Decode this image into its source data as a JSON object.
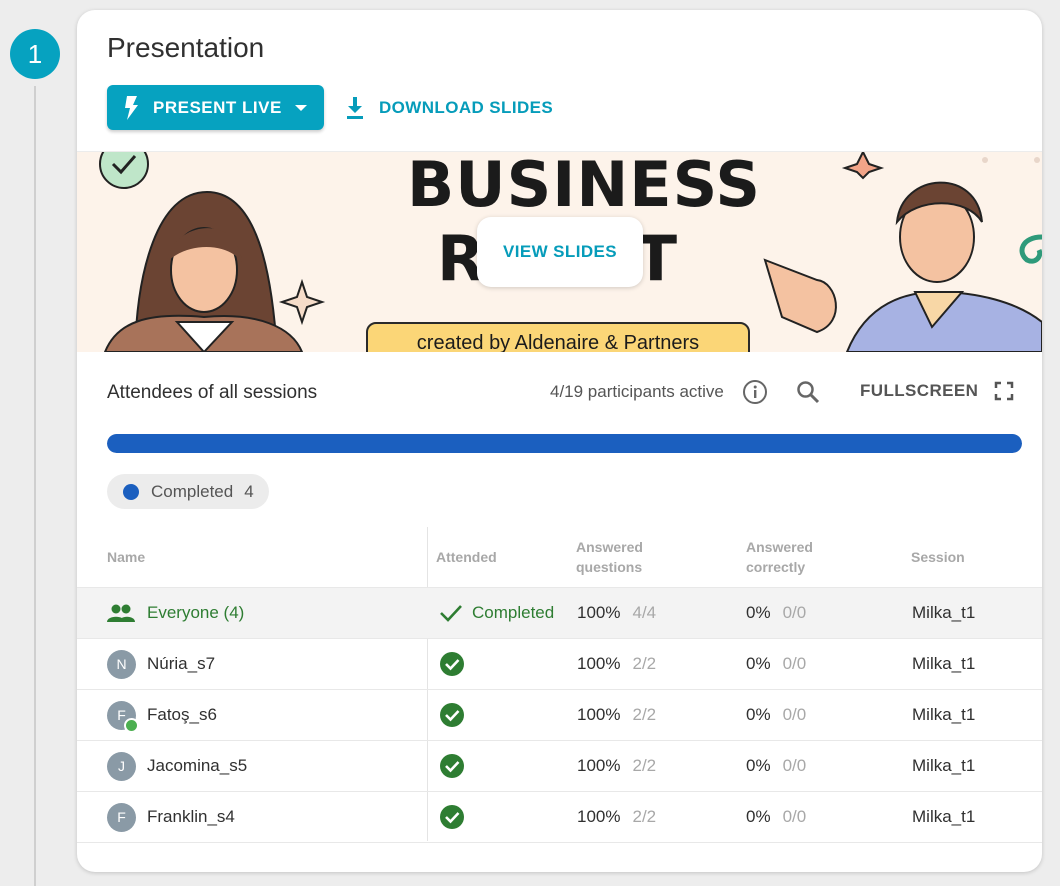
{
  "step": {
    "number": "1"
  },
  "card": {
    "title": "Presentation",
    "present_label": "PRESENT LIVE",
    "download_label": "DOWNLOAD SLIDES",
    "view_slides_label": "VIEW SLIDES"
  },
  "slide": {
    "line1": "BUSINESS",
    "line2_start": "R",
    "line2_end": "T",
    "banner": "created by Aldenaire & Partners"
  },
  "attendees": {
    "title": "Attendees of all sessions",
    "active_text": "4/19 participants active",
    "fullscreen_label": "FULLSCREEN",
    "progress_fraction": 1.0,
    "progress_color": "#1b5fbf",
    "chip_label": "Completed",
    "chip_count": "4"
  },
  "table": {
    "headers": {
      "name": "Name",
      "attended": "Attended",
      "answered_1": "Answered",
      "answered_2": "questions",
      "correct_1": "Answered",
      "correct_2": "correctly",
      "session": "Session"
    },
    "group": {
      "name": "Everyone (4)",
      "attended": "Completed",
      "answered_pct": "100%",
      "answered_frac": "4/4",
      "correct_pct": "0%",
      "correct_frac": "0/0",
      "session": "Milka_t1"
    },
    "rows": [
      {
        "initial": "N",
        "name": "Núria_s7",
        "answered_pct": "100%",
        "answered_frac": "2/2",
        "correct_pct": "0%",
        "correct_frac": "0/0",
        "session": "Milka_t1"
      },
      {
        "initial": "F",
        "name": "Fatoş_s6",
        "answered_pct": "100%",
        "answered_frac": "2/2",
        "correct_pct": "0%",
        "correct_frac": "0/0",
        "session": "Milka_t1"
      },
      {
        "initial": "J",
        "name": "Jacomina_s5",
        "answered_pct": "100%",
        "answered_frac": "2/2",
        "correct_pct": "0%",
        "correct_frac": "0/0",
        "session": "Milka_t1"
      },
      {
        "initial": "F",
        "name": "Franklin_s4",
        "answered_pct": "100%",
        "answered_frac": "2/2",
        "correct_pct": "0%",
        "correct_frac": "0/0",
        "session": "Milka_t1"
      }
    ]
  },
  "colors": {
    "accent": "#06a2c0",
    "success": "#2e7d32",
    "progress": "#1b5fbf"
  },
  "icons": [
    "bolt-icon",
    "caret-down-icon",
    "download-icon",
    "info-icon",
    "search-icon",
    "fullscreen-icon",
    "group-icon",
    "check-icon",
    "check-circle-icon"
  ]
}
